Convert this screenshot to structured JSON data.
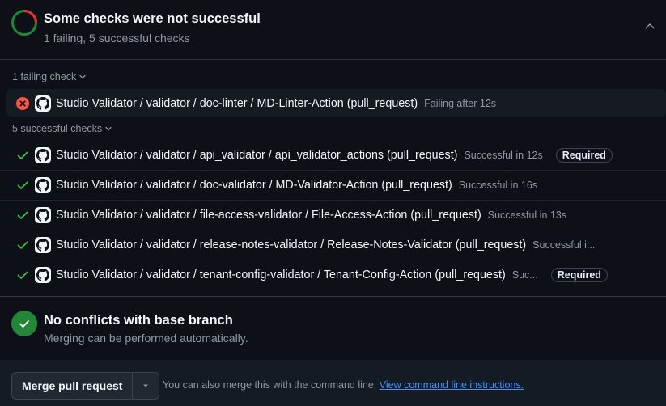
{
  "header": {
    "title": "Some checks were not successful",
    "subtitle": "1 failing, 5 successful checks",
    "ring_colors": {
      "failing": "#da3633",
      "success": "#238636"
    }
  },
  "failing_section": {
    "label": "1 failing check",
    "checks": [
      {
        "name": "Studio Validator / validator / doc-linter / MD-Linter-Action (pull_request)",
        "status": "Failing after 12s",
        "required": ""
      }
    ]
  },
  "success_section": {
    "label": "5 successful checks",
    "checks": [
      {
        "name": "Studio Validator / validator / api_validator / api_validator_actions (pull_request)",
        "status": "Successful in 12s",
        "required": "Required"
      },
      {
        "name": "Studio Validator / validator / doc-validator / MD-Validator-Action (pull_request)",
        "status": "Successful in 16s",
        "required": ""
      },
      {
        "name": "Studio Validator / validator / file-access-validator / File-Access-Action (pull_request)",
        "status": "Successful in 13s",
        "required": ""
      },
      {
        "name": "Studio Validator / validator / release-notes-validator / Release-Notes-Validator (pull_request)",
        "status": "Successful i...",
        "required": ""
      },
      {
        "name": "Studio Validator / validator / tenant-config-validator / Tenant-Config-Action (pull_request)",
        "status": "Suc...",
        "required": "Required"
      }
    ]
  },
  "merge_status": {
    "title": "No conflicts with base branch",
    "subtitle": "Merging can be performed automatically."
  },
  "merge_bar": {
    "button_label": "Merge pull request",
    "hint_text": "You can also merge this with the command line.",
    "link_text": "View command line instructions."
  },
  "icons": {
    "ring": "checks-status-ring-icon",
    "collapse": "chevron-up-icon",
    "fail": "x-circle-fill-icon",
    "success": "check-icon",
    "avatar": "github-mark-icon",
    "merge_ok": "check-circle-icon",
    "dropdown": "triangle-down-icon"
  }
}
